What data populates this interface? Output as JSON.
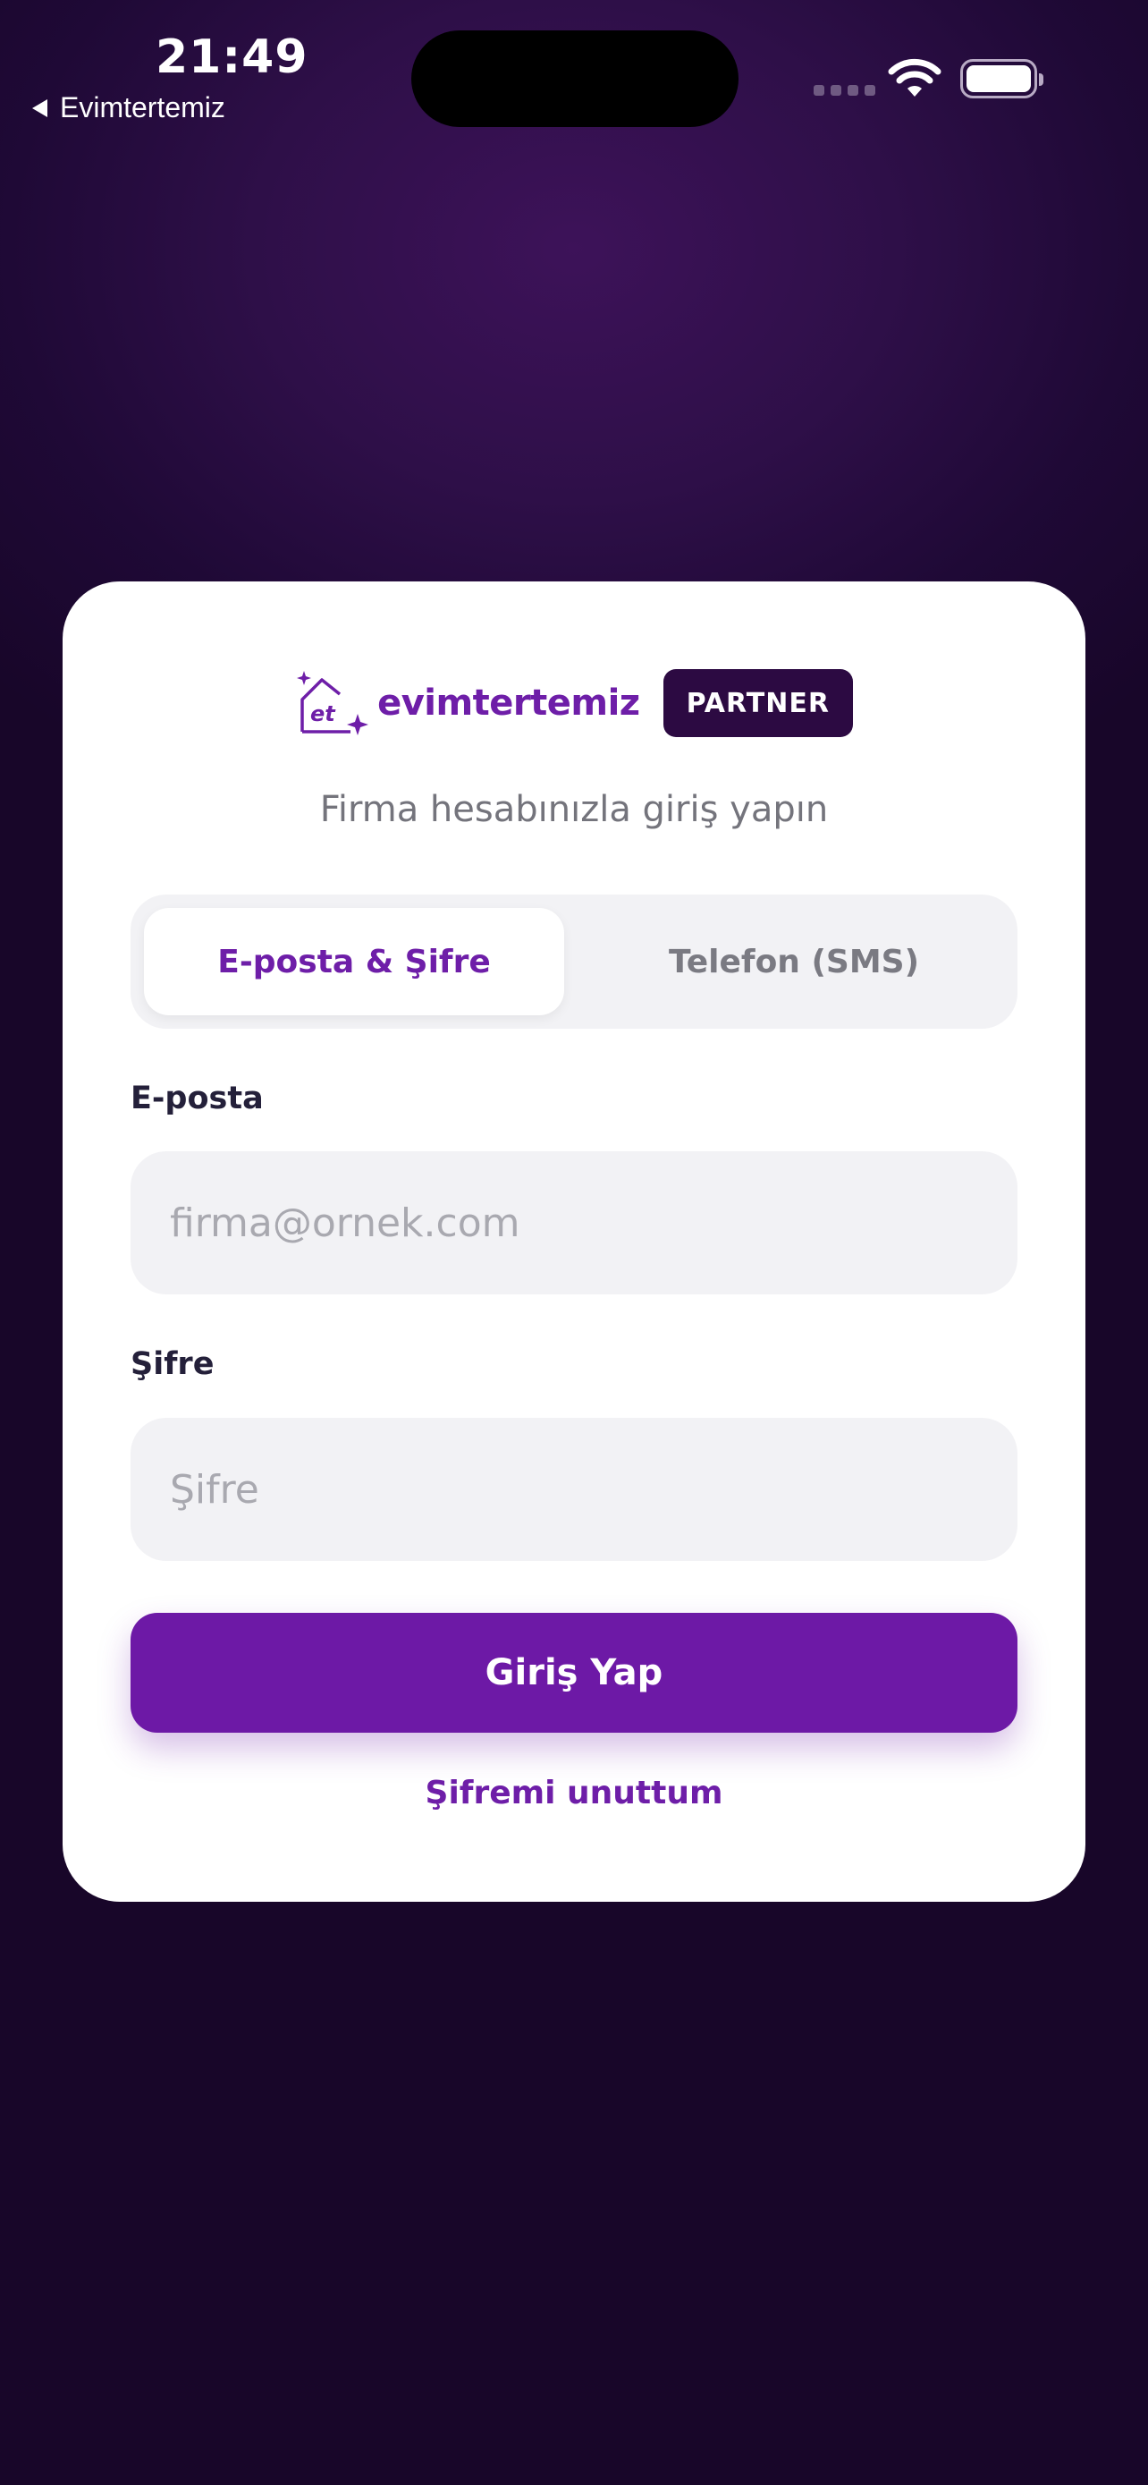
{
  "status_bar": {
    "time": "21:49",
    "back_app": "Evimtertemiz"
  },
  "brand": {
    "logo_mark": "et",
    "logo_text": "evimtertemiz",
    "badge": "PARTNER"
  },
  "login": {
    "subtitle": "Firma hesabınızla giriş yapın",
    "tabs": [
      {
        "label": "E-posta & Şifre",
        "active": true
      },
      {
        "label": "Telefon (SMS)",
        "active": false
      }
    ],
    "email": {
      "label": "E-posta",
      "placeholder": "firma@ornek.com",
      "value": ""
    },
    "password": {
      "label": "Şifre",
      "placeholder": "Şifre",
      "value": ""
    },
    "submit_label": "Giriş Yap",
    "forgot_label": "Şifremi unuttum"
  },
  "colors": {
    "accent": "#6e1ea8",
    "badge_bg": "#2c0a42",
    "background": "#2a0c40"
  }
}
